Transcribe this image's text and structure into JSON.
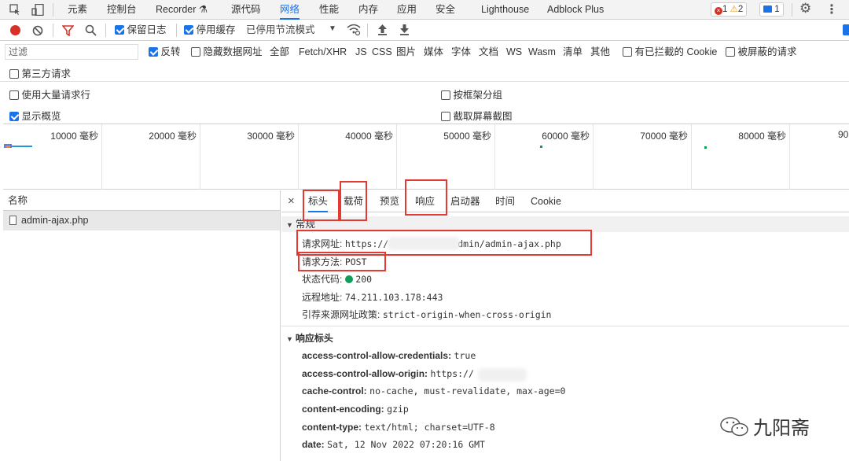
{
  "topbar": {
    "tabs": [
      "元素",
      "控制台",
      "Recorder",
      "源代码",
      "网络",
      "性能",
      "内存",
      "应用",
      "安全",
      "Lighthouse",
      "Adblock Plus"
    ],
    "recorder_icon": "flask-icon",
    "errors": "1",
    "warnings": "2",
    "messages": "1"
  },
  "toolbar": {
    "preserve_log": "保留日志",
    "disable_cache": "停用缓存",
    "throttle": "已停用节流模式"
  },
  "filter": {
    "placeholder": "过滤",
    "invert": "反转",
    "hide_data_urls": "隐藏数据网址",
    "types": [
      "全部",
      "Fetch/XHR",
      "JS",
      "CSS",
      "图片",
      "媒体",
      "字体",
      "文档",
      "WS",
      "Wasm",
      "清单",
      "其他"
    ],
    "blocked_cookies": "有已拦截的 Cookie",
    "blocked_requests": "被屏蔽的请求",
    "third_party": "第三方请求"
  },
  "options": {
    "large_rows": "使用大量请求行",
    "group_by_frame": "按框架分组",
    "show_overview": "显示概览",
    "capture_screenshots": "截取屏幕截图"
  },
  "overview": {
    "ticks": [
      "10000 毫秒",
      "20000 毫秒",
      "30000 毫秒",
      "40000 毫秒",
      "50000 毫秒",
      "60000 毫秒",
      "70000 毫秒",
      "80000 毫秒",
      "90"
    ]
  },
  "requests": {
    "header": "名称",
    "items": [
      "admin-ajax.php"
    ]
  },
  "details": {
    "close": "×",
    "tabs": [
      "标头",
      "载荷",
      "预览",
      "响应",
      "启动器",
      "时间",
      "Cookie"
    ],
    "general": {
      "title": "常规",
      "rows": [
        {
          "key": "请求网址:",
          "value": "https://"
        },
        {
          "key": "请求方法:",
          "value": "POST"
        },
        {
          "key": "状态代码:",
          "value": "200"
        },
        {
          "key": "远程地址:",
          "value": "74.211.103.178:443"
        },
        {
          "key": "引荐来源网址政策:",
          "value": "strict-origin-when-cross-origin"
        }
      ],
      "url_suffix": "dmin/admin-ajax.php"
    },
    "response_headers": {
      "title": "响应标头",
      "rows": [
        {
          "key": "access-control-allow-credentials:",
          "value": "true"
        },
        {
          "key": "access-control-allow-origin:",
          "value": "https://"
        },
        {
          "key": "cache-control:",
          "value": "no-cache, must-revalidate, max-age=0"
        },
        {
          "key": "content-encoding:",
          "value": "gzip"
        },
        {
          "key": "content-type:",
          "value": "text/html; charset=UTF-8"
        },
        {
          "key": "date:",
          "value": "Sat, 12 Nov 2022 07:20:16 GMT"
        }
      ]
    }
  },
  "watermark": "九阳斋"
}
